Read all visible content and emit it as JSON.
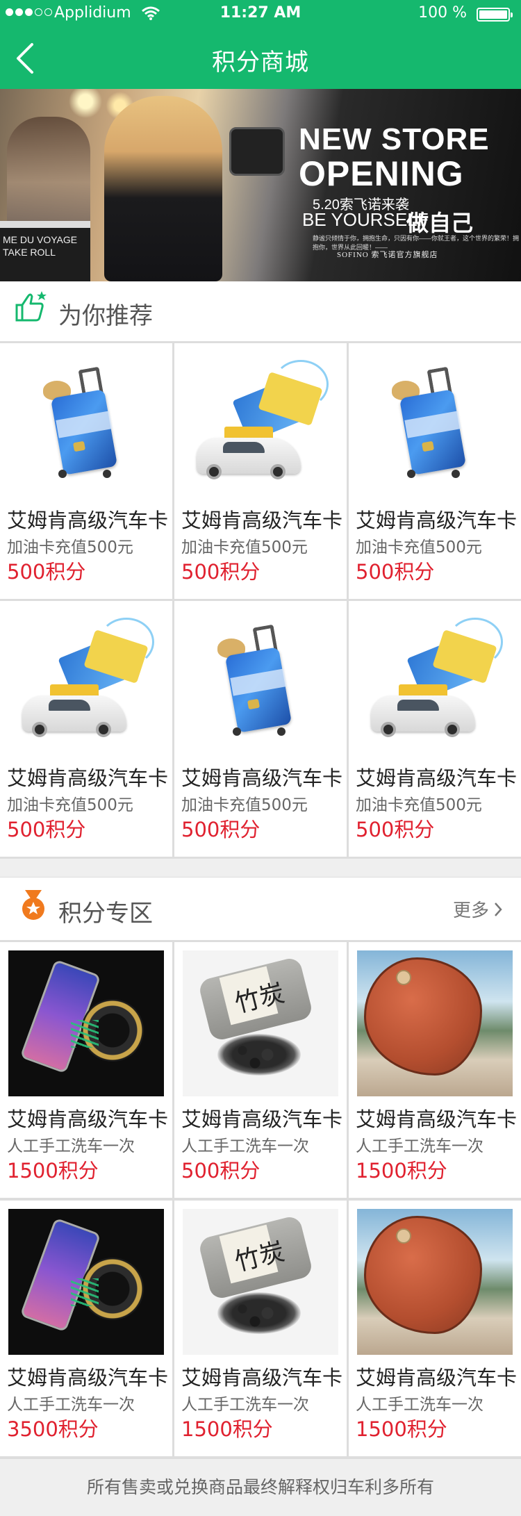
{
  "status_bar": {
    "carrier": "Applidium",
    "time": "11:27 AM",
    "battery": "100 %"
  },
  "nav": {
    "title": "积分商城"
  },
  "banner": {
    "line1": "NEW STORE",
    "line2": "OPENING",
    "sub": "5.20索飞诺来袭",
    "slogan": "BE YOURSELF",
    "slogan_cn": "做自己",
    "tiny": "静谧只倾情于你，拥抱生命，只因有你——你就王者，这个世界的繁荣！拥抱你，世界从此回暖！——",
    "brand": "SOFINO 索飞诺官方旗舰店",
    "clapper": [
      "ME DU VOYAGE",
      "TAKE   ROLL"
    ]
  },
  "recommend": {
    "title": "为你推荐",
    "items": [
      {
        "name": "艾姆肯高级汽车卡",
        "desc": "加油卡充值500元",
        "price": "500积分",
        "img": "suitcase"
      },
      {
        "name": "艾姆肯高级汽车卡",
        "desc": "加油卡充值500元",
        "price": "500积分",
        "img": "carcard"
      },
      {
        "name": "艾姆肯高级汽车卡",
        "desc": "加油卡充值500元",
        "price": "500积分",
        "img": "suitcase"
      },
      {
        "name": "艾姆肯高级汽车卡",
        "desc": "加油卡充值500元",
        "price": "500积分",
        "img": "carcard"
      },
      {
        "name": "艾姆肯高级汽车卡",
        "desc": "加油卡充值500元",
        "price": "500积分",
        "img": "suitcase"
      },
      {
        "name": "艾姆肯高级汽车卡",
        "desc": "加油卡充值500元",
        "price": "500积分",
        "img": "carcard"
      }
    ]
  },
  "zone": {
    "title": "积分专区",
    "more": "更多",
    "items": [
      {
        "name": "艾姆肯高级汽车卡",
        "desc": "人工手工洗车一次",
        "price": "1500积分",
        "img": "holder"
      },
      {
        "name": "艾姆肯高级汽车卡",
        "desc": "人工手工洗车一次",
        "price": "500积分",
        "img": "bag"
      },
      {
        "name": "艾姆肯高级汽车卡",
        "desc": "人工手工洗车一次",
        "price": "1500积分",
        "img": "pillow"
      },
      {
        "name": "艾姆肯高级汽车卡",
        "desc": "人工手工洗车一次",
        "price": "3500积分",
        "img": "holder"
      },
      {
        "name": "艾姆肯高级汽车卡",
        "desc": "人工手工洗车一次",
        "price": "1500积分",
        "img": "bag"
      },
      {
        "name": "艾姆肯高级汽车卡",
        "desc": "人工手工洗车一次",
        "price": "1500积分",
        "img": "pillow"
      }
    ]
  },
  "bag_text": "竹炭",
  "footer": {
    "text": "所有售卖或兑换商品最终解释权归车利多所有"
  },
  "colors": {
    "brand_green": "#15b86e",
    "price_red": "#e0212f",
    "medal_orange": "#f07a1e"
  }
}
